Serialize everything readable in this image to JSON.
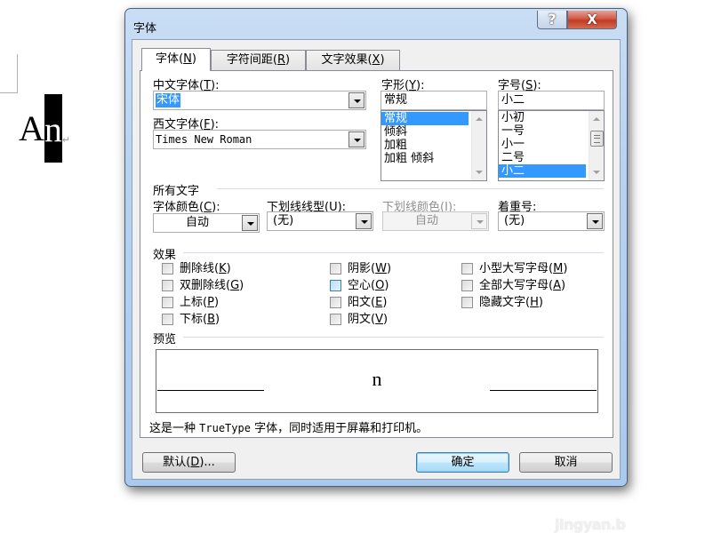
{
  "document": {
    "text_plain": "A",
    "text_selected": "n",
    "paragraph_mark": "↵"
  },
  "watermark": "jingyan.b",
  "dialog": {
    "title": "字体",
    "help_glyph": "?",
    "close_glyph": "X",
    "tabs": [
      {
        "label": "字体",
        "key": "N",
        "active": true
      },
      {
        "label": "字符间距",
        "key": "R",
        "active": false
      },
      {
        "label": "文字效果",
        "key": "X",
        "active": false
      }
    ],
    "chinese_font": {
      "label": "中文字体",
      "key": "T",
      "value": "宋体"
    },
    "western_font": {
      "label": "西文字体",
      "key": "F",
      "value": "Times New Roman"
    },
    "font_style": {
      "label": "字形",
      "key": "Y",
      "value": "常规",
      "options": [
        "常规",
        "倾斜",
        "加粗",
        "加粗  倾斜"
      ],
      "selected": "常规"
    },
    "font_size": {
      "label": "字号",
      "key": "S",
      "value": "小二",
      "options": [
        "小初",
        "一号",
        "小一",
        "二号",
        "小二"
      ],
      "selected": "小二"
    },
    "all_text": {
      "section": "所有文字",
      "font_color": {
        "label": "字体颜色",
        "key": "C",
        "value": "自动"
      },
      "underline_style": {
        "label": "下划线线型",
        "key": "U",
        "value": "(无)"
      },
      "underline_color": {
        "label": "下划线颜色",
        "key": "I",
        "value": "自动",
        "disabled": true
      },
      "emphasis": {
        "label": "着重号",
        "key": ":",
        "value": "(无)"
      }
    },
    "effects": {
      "section": "效果",
      "items": [
        {
          "label": "删除线",
          "key": "K",
          "checked": false
        },
        {
          "label": "双删除线",
          "key": "G",
          "checked": false
        },
        {
          "label": "上标",
          "key": "P",
          "checked": false
        },
        {
          "label": "下标",
          "key": "B",
          "checked": false
        },
        {
          "label": "阴影",
          "key": "W",
          "checked": false
        },
        {
          "label": "空心",
          "key": "O",
          "checked": false,
          "hover": true
        },
        {
          "label": "阳文",
          "key": "E",
          "checked": false
        },
        {
          "label": "阴文",
          "key": "V",
          "checked": false
        },
        {
          "label": "小型大写字母",
          "key": "M",
          "checked": false
        },
        {
          "label": "全部大写字母",
          "key": "A",
          "checked": false
        },
        {
          "label": "隐藏文字",
          "key": "H",
          "checked": false
        }
      ]
    },
    "preview": {
      "section": "预览",
      "sample": "n",
      "description_pre": "这是一种 ",
      "description_mono": "TrueType",
      "description_post": " 字体，同时适用于屏幕和打印机。"
    },
    "buttons": {
      "default": {
        "label": "默认",
        "key": "D",
        "suffix": "..."
      },
      "ok": "确定",
      "cancel": "取消"
    }
  }
}
